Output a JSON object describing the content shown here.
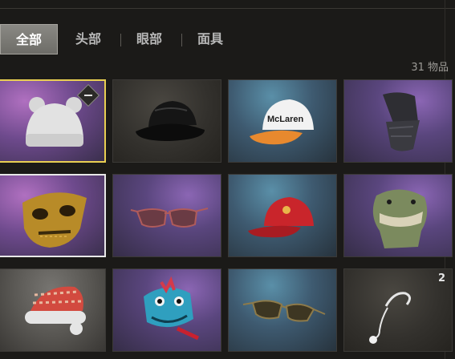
{
  "tabs": [
    {
      "label": "全部",
      "active": true
    },
    {
      "label": "头部",
      "active": false
    },
    {
      "label": "眼部",
      "active": false
    },
    {
      "label": "面具",
      "active": false
    }
  ],
  "item_count": "31 物品",
  "items": [
    {
      "name": "white-bear-beanie",
      "quantity": ""
    },
    {
      "name": "black-bucket-hat",
      "quantity": ""
    },
    {
      "name": "mclaren-cap",
      "brand_text": "McLaren",
      "quantity": ""
    },
    {
      "name": "black-face-scarf",
      "quantity": ""
    },
    {
      "name": "gold-skull-mask",
      "quantity": ""
    },
    {
      "name": "aviator-glasses",
      "quantity": ""
    },
    {
      "name": "red-cap",
      "quantity": ""
    },
    {
      "name": "dinosaur-mask",
      "quantity": ""
    },
    {
      "name": "santa-hat",
      "quantity": ""
    },
    {
      "name": "blue-dragon-hood",
      "quantity": ""
    },
    {
      "name": "sunglasses",
      "quantity": ""
    },
    {
      "name": "headset-microphone",
      "quantity": "2"
    }
  ],
  "colors": {
    "selected_yellow": "#e9cf52",
    "selected_white": "#e8e8e8"
  }
}
